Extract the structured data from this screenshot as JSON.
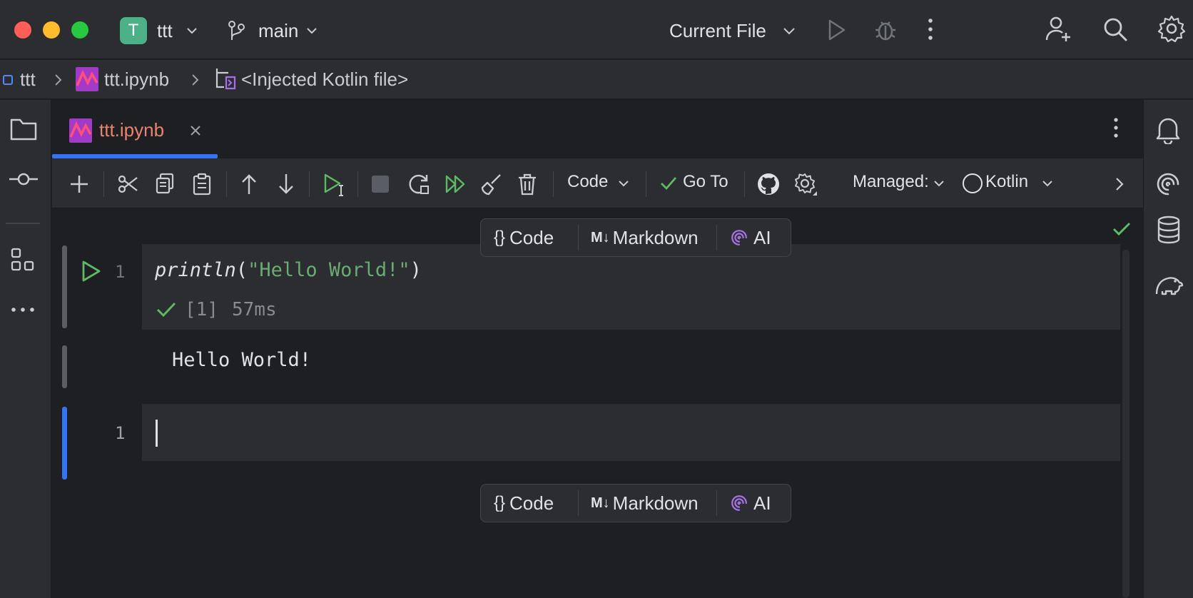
{
  "window": {
    "traffic_lights": {
      "close": "#ff5f57",
      "minimize": "#febc2e",
      "zoom": "#28c840"
    },
    "project": {
      "badge": "T",
      "name": "ttt",
      "badge_color": "#4eb089"
    },
    "branch": "main",
    "run_config": "Current File"
  },
  "breadcrumb": {
    "items": [
      "ttt",
      "ttt.ipynb",
      "<Injected Kotlin file>"
    ]
  },
  "tabs": [
    {
      "label": "ttt.ipynb",
      "active": true,
      "color": "#e8846e"
    }
  ],
  "toolbar": {
    "cell_type": "Code",
    "goto_label": "Go To",
    "managed_label": "Managed:",
    "kernel": "Kotlin"
  },
  "add_cell_bar": {
    "code": "Code",
    "markdown_icon": "M↓",
    "markdown": "Markdown",
    "ai": "AI"
  },
  "cells": [
    {
      "line_number": "1",
      "code_fn": "println",
      "code_open": "(",
      "code_string": "\"Hello World!\"",
      "code_close": ")",
      "exec_count": "[1]",
      "exec_time": "57ms",
      "output": "Hello World!"
    },
    {
      "line_number": "1",
      "code": ""
    }
  ],
  "colors": {
    "accent": "#3574f0",
    "success": "#5fb865",
    "string": "#6aab73",
    "ai": "#a571e6"
  }
}
